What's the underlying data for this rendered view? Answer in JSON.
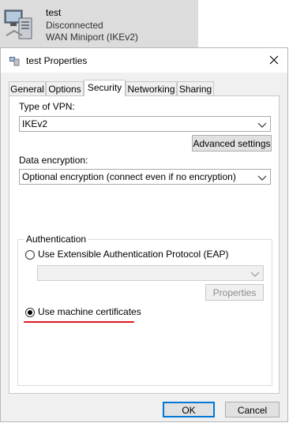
{
  "connection": {
    "name": "test",
    "status": "Disconnected",
    "device": "WAN Miniport (IKEv2)"
  },
  "dialog": {
    "title": "test Properties",
    "tabs": [
      {
        "label": "General"
      },
      {
        "label": "Options"
      },
      {
        "label": "Security"
      },
      {
        "label": "Networking"
      },
      {
        "label": "Sharing"
      }
    ],
    "active_tab": "Security"
  },
  "security": {
    "vpn_type_label": "Type of VPN:",
    "vpn_type_value": "IKEv2",
    "advanced_settings_label": "Advanced settings",
    "encryption_label": "Data encryption:",
    "encryption_value": "Optional encryption (connect even if no encryption)",
    "auth_group_label": "Authentication",
    "eap_option_label": "Use Extensible Authentication Protocol (EAP)",
    "eap_selected": false,
    "eap_combo_value": "",
    "properties_label": "Properties",
    "machine_cert_label": "Use machine certificates",
    "machine_cert_selected": true
  },
  "footer": {
    "ok_label": "OK",
    "cancel_label": "Cancel"
  },
  "colors": {
    "annotation_underline": "#e0181b",
    "selected_item_background": "#dcdcdc",
    "dialog_background": "#f0f0f0"
  },
  "icons": [
    "vpn-connection-icon",
    "properties-window-icon",
    "close-icon",
    "chevron-down-icon"
  ]
}
